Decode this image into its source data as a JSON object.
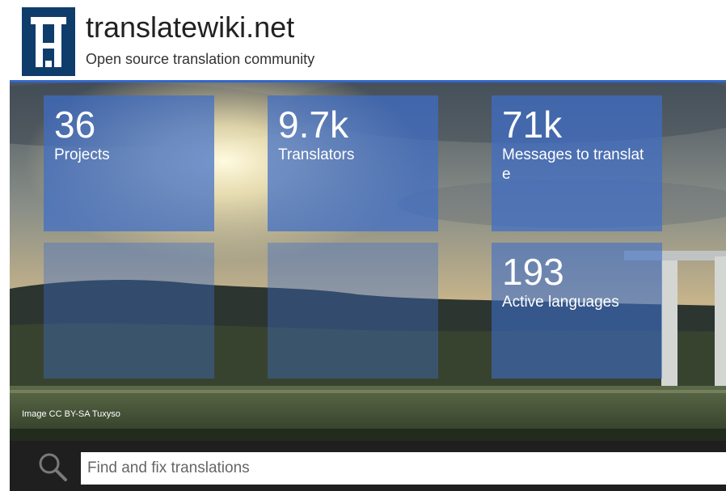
{
  "header": {
    "logo_icon": "translatewiki-logo-icon",
    "title": "translatewiki.net",
    "tagline": "Open source translation community"
  },
  "colors": {
    "accent": "#3366cc",
    "logo": "#0e3d6c",
    "tile": "#3e6ec8",
    "search_bar": "#1f1f1f"
  },
  "stats": {
    "projects": {
      "value": "36",
      "label": "Projects"
    },
    "translators": {
      "value": "9.7k",
      "label": "Translators"
    },
    "messages": {
      "value": "71k",
      "label": "Messages to translate"
    },
    "languages": {
      "value": "193",
      "label": "Active languages"
    }
  },
  "hero": {
    "credit": "Image CC BY-SA Tuxyso"
  },
  "search": {
    "icon": "search-icon",
    "placeholder": "Find and fix translations"
  }
}
